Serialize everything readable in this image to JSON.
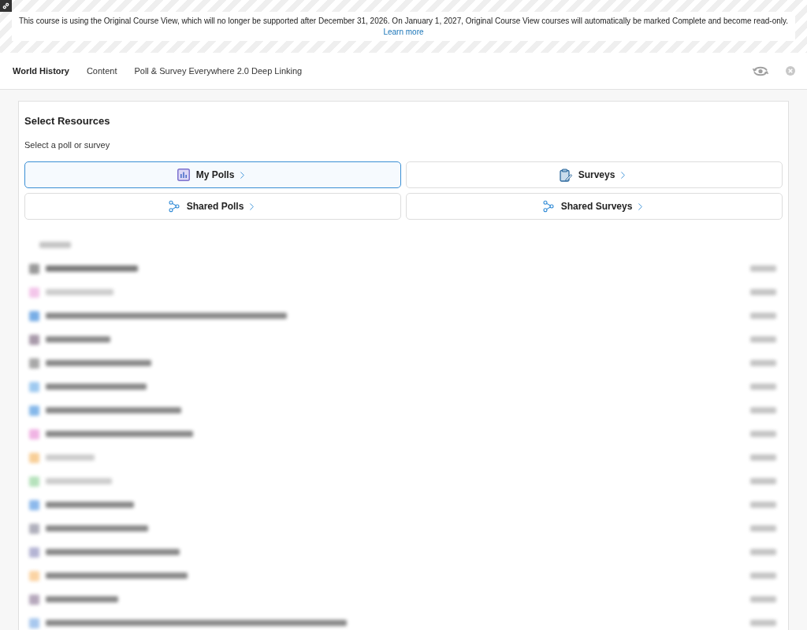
{
  "banner": {
    "message": "This course is using the Original Course View, which will no longer be supported after December 31, 2026. On January 1, 2027, Original Course View courses will automatically be marked Complete and become read-only.",
    "link": "Learn more"
  },
  "course_title": "World History",
  "breadcrumbs": [
    "Content",
    "Poll & Survey Everywhere 2.0 Deep Linking"
  ],
  "panel": {
    "title": "Select Resources",
    "instruction": "Select a poll or survey",
    "options": [
      {
        "label": "My Polls",
        "kind": "polls",
        "selected": true
      },
      {
        "label": "Surveys",
        "kind": "surveys",
        "selected": false
      },
      {
        "label": "Shared Polls",
        "kind": "shared",
        "selected": false
      },
      {
        "label": "Shared Surveys",
        "kind": "shared",
        "selected": false
      }
    ]
  }
}
